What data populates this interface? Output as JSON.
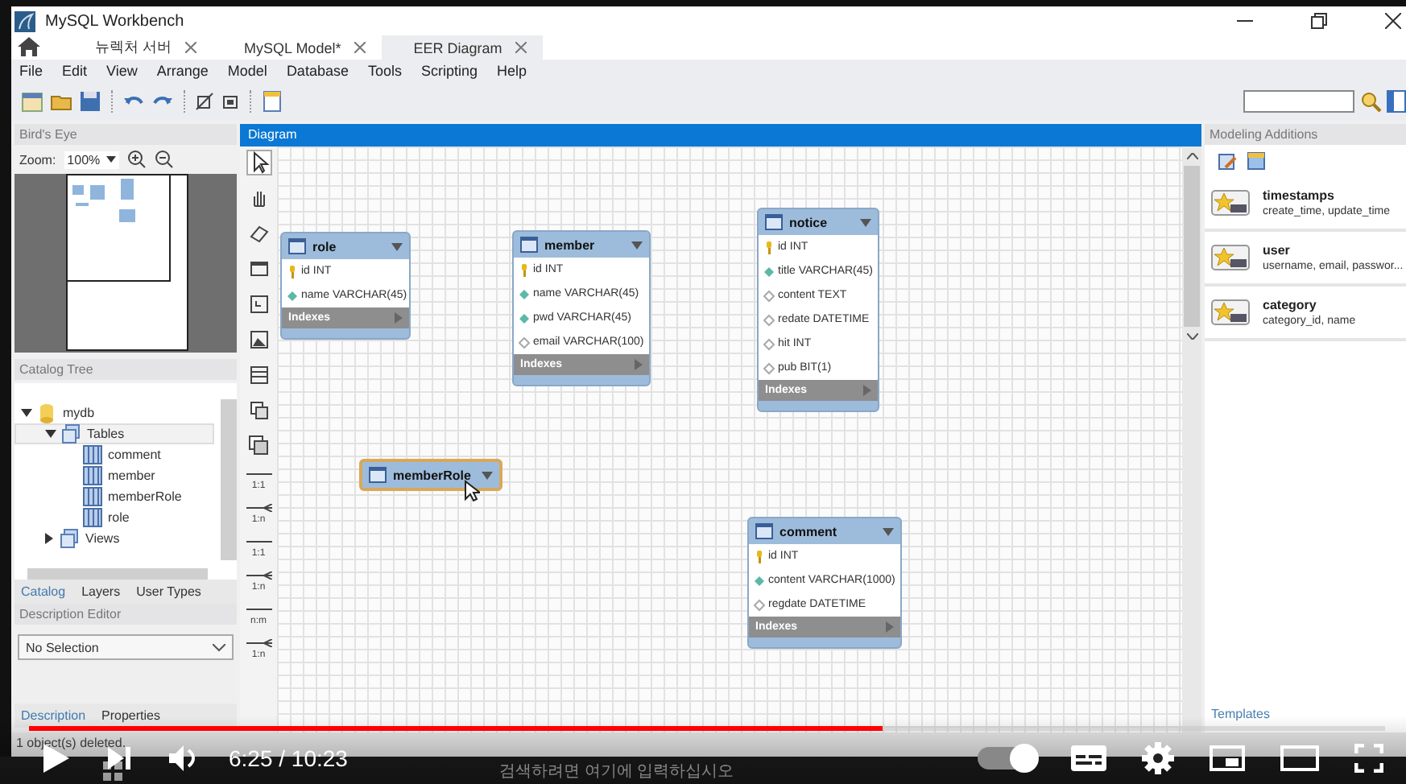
{
  "window": {
    "title": "MySQL Workbench"
  },
  "tabs": [
    {
      "label": "뉴렉처 서버",
      "selected": false
    },
    {
      "label": "MySQL Model*",
      "selected": false
    },
    {
      "label": "EER Diagram",
      "selected": true
    }
  ],
  "menu": [
    "File",
    "Edit",
    "View",
    "Arrange",
    "Model",
    "Database",
    "Tools",
    "Scripting",
    "Help"
  ],
  "birds_eye": {
    "title": "Bird's Eye",
    "zoom_label": "Zoom:",
    "zoom_value": "100%"
  },
  "catalog": {
    "title": "Catalog Tree",
    "tree": [
      {
        "label": "mydb",
        "kind": "schema",
        "expanded": true,
        "selected": false,
        "children": [
          {
            "label": "Tables",
            "kind": "folder",
            "expanded": true,
            "selected": true,
            "children": [
              {
                "label": "comment",
                "kind": "table",
                "selected": false
              },
              {
                "label": "member",
                "kind": "table",
                "selected": false
              },
              {
                "label": "memberRole",
                "kind": "table",
                "selected": false
              },
              {
                "label": "role",
                "kind": "table",
                "selected": false
              }
            ]
          },
          {
            "label": "Views",
            "kind": "folder",
            "expanded": false,
            "selected": false
          }
        ]
      }
    ]
  },
  "catalog_tabs": [
    {
      "label": "Catalog",
      "selected": true
    },
    {
      "label": "Layers",
      "selected": false
    },
    {
      "label": "User Types",
      "selected": false
    }
  ],
  "description_editor": {
    "title": "Description Editor",
    "selection": "No Selection"
  },
  "bottom_tabs": [
    {
      "label": "Description",
      "selected": true
    },
    {
      "label": "Properties",
      "selected": false
    }
  ],
  "diagram": {
    "title": "Diagram",
    "relationship_tools": [
      "1:1",
      "1:n",
      "1:1",
      "1:n",
      "n:m",
      "1:n"
    ],
    "tables": [
      {
        "name": "role",
        "selected": false,
        "indexes": "Indexes",
        "columns": [
          {
            "name": "id INT",
            "kind": "pk"
          },
          {
            "name": "name VARCHAR(45)",
            "kind": "nn"
          }
        ]
      },
      {
        "name": "member",
        "selected": false,
        "indexes": "Indexes",
        "columns": [
          {
            "name": "id INT",
            "kind": "pk"
          },
          {
            "name": "name VARCHAR(45)",
            "kind": "nn"
          },
          {
            "name": "pwd VARCHAR(45)",
            "kind": "nn"
          },
          {
            "name": "email VARCHAR(100)",
            "kind": "plain"
          }
        ]
      },
      {
        "name": "notice",
        "selected": false,
        "indexes": "Indexes",
        "columns": [
          {
            "name": "id INT",
            "kind": "pk"
          },
          {
            "name": "title VARCHAR(45)",
            "kind": "nn"
          },
          {
            "name": "content TEXT",
            "kind": "plain"
          },
          {
            "name": "redate DATETIME",
            "kind": "plain"
          },
          {
            "name": "hit INT",
            "kind": "plain"
          },
          {
            "name": "pub BIT(1)",
            "kind": "plain"
          }
        ]
      },
      {
        "name": "memberRole",
        "selected": true
      },
      {
        "name": "comment",
        "selected": false,
        "indexes": "Indexes",
        "columns": [
          {
            "name": "id INT",
            "kind": "pk"
          },
          {
            "name": "content VARCHAR(1000)",
            "kind": "nn"
          },
          {
            "name": "regdate DATETIME",
            "kind": "plain"
          }
        ]
      }
    ]
  },
  "modeling_additions": {
    "title": "Modeling Additions",
    "items": [
      {
        "name": "timestamps",
        "fields": "create_time, update_time"
      },
      {
        "name": "user",
        "fields": "username, email, passwor..."
      },
      {
        "name": "category",
        "fields": "category_id, name"
      }
    ],
    "tab": "Templates"
  },
  "status_bar": "1 object(s) deleted.",
  "player": {
    "level": 0.63,
    "time": "6:25 / 10:23",
    "autoplay_on": true
  },
  "taskbar": {
    "search_placeholder": "검색하려면 여기에 입력하십시오"
  }
}
